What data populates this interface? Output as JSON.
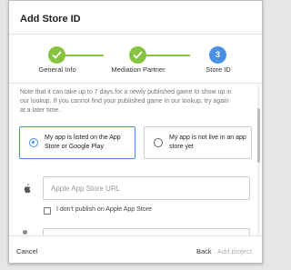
{
  "dialog": {
    "title": "Add Store ID"
  },
  "stepper": {
    "steps": [
      {
        "label": "General Info",
        "state": "complete"
      },
      {
        "label": "Mediation Partner",
        "state": "complete"
      },
      {
        "label": "Store ID",
        "state": "current",
        "number": "3"
      }
    ],
    "complete_color": "#86c440",
    "current_color": "#4a90e2"
  },
  "note": "Note that it can take up to 7 days for a newly published game to show up in our lookup. If you cannot find your published game in our lookup, try again at a later time.",
  "options": [
    {
      "label": "My app is listed on the App Store or Google Play",
      "selected": true
    },
    {
      "label": "My app is not live in an app store yet",
      "selected": false
    }
  ],
  "apple_store": {
    "icon": "apple-icon",
    "placeholder": "Apple App Store URL",
    "value": "",
    "checkbox_label": "I don't publish on Apple App Store"
  },
  "footer": {
    "cancel_label": "Cancel",
    "back_label": "Back",
    "add_label": "Add project"
  }
}
